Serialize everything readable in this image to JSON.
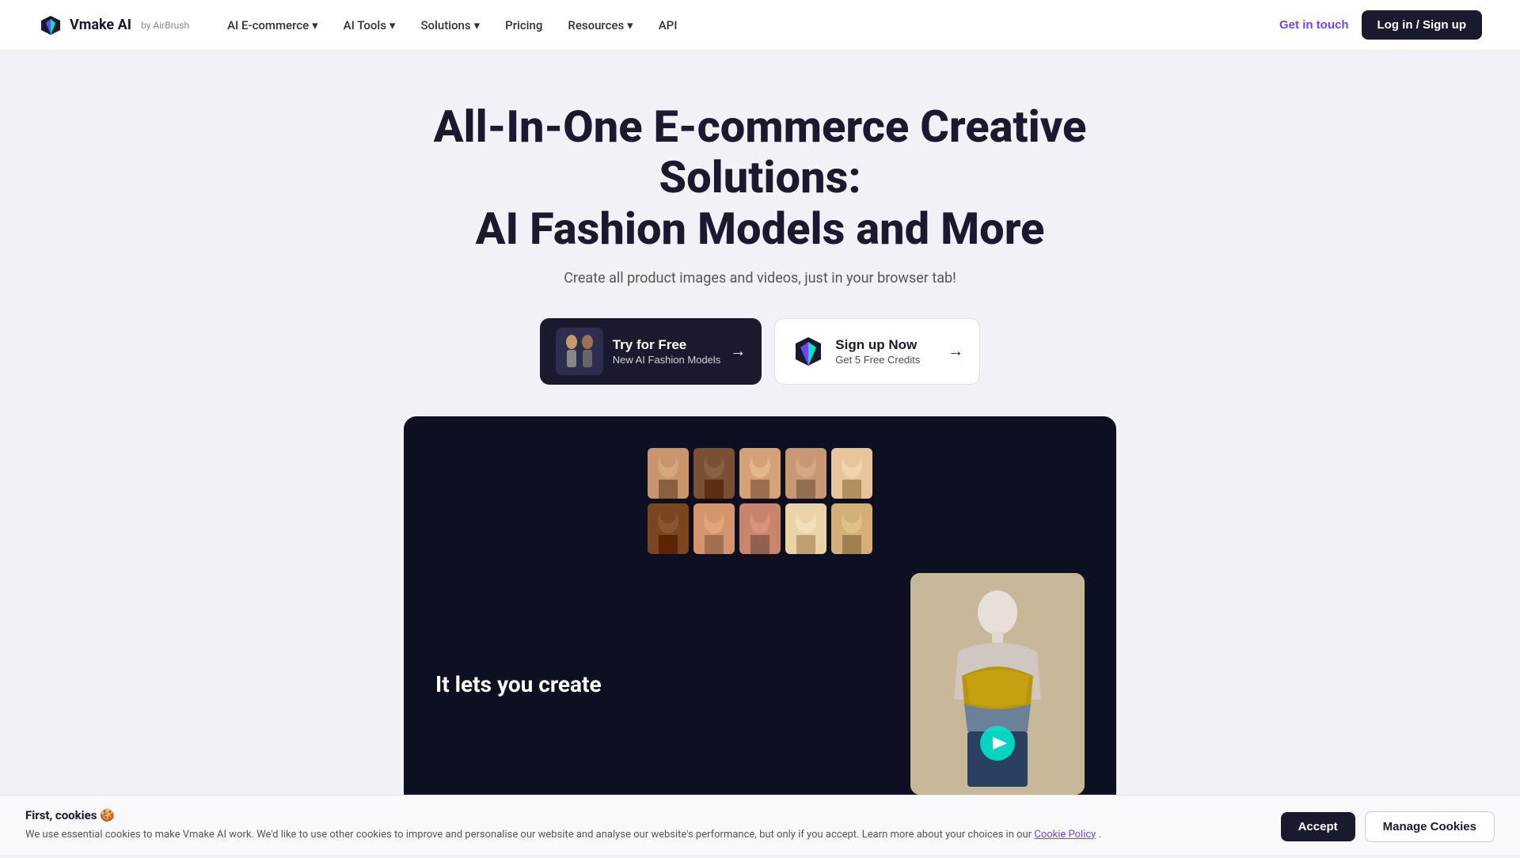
{
  "brand": {
    "name": "Vmake AI",
    "sub": "by AirBrush",
    "logo_letter": "V"
  },
  "nav": {
    "links": [
      {
        "label": "AI E-commerce",
        "id": "ai-ecommerce"
      },
      {
        "label": "AI Tools",
        "id": "ai-tools"
      },
      {
        "label": "Solutions",
        "id": "solutions"
      },
      {
        "label": "Pricing",
        "id": "pricing"
      },
      {
        "label": "Resources",
        "id": "resources"
      },
      {
        "label": "API",
        "id": "api"
      }
    ],
    "get_in_touch": "Get in touch",
    "login": "Log in / Sign up"
  },
  "hero": {
    "title_line1": "All-In-One E-commerce Creative Solutions:",
    "title_line2": "AI Fashion Models and More",
    "subtitle": "Create all product images and videos, just in your browser tab!"
  },
  "cta": {
    "primary": {
      "title": "Try for Free",
      "subtitle": "New AI Fashion Models",
      "aria": "try-for-free-button"
    },
    "secondary": {
      "title": "Sign up Now",
      "subtitle": "Get 5 Free Credits",
      "aria": "sign-up-button"
    }
  },
  "panel": {
    "tagline": "It lets you create"
  },
  "cookie": {
    "title": "First, cookies 🍪",
    "body": "We use essential cookies to make Vmake AI work. We'd like to use other cookies to improve and personalise our website and analyse our website's performance, but only if you accept. Learn more about your choices in our",
    "link_text": "Cookie Policy",
    "accept_label": "Accept",
    "manage_label": "Manage Cookies"
  },
  "faces": [
    {
      "class": "f1"
    },
    {
      "class": "f2"
    },
    {
      "class": "f3"
    },
    {
      "class": "f4"
    },
    {
      "class": "f5"
    },
    {
      "class": "f6"
    },
    {
      "class": "f7"
    },
    {
      "class": "f8"
    },
    {
      "class": "f9"
    },
    {
      "class": "f10"
    }
  ]
}
